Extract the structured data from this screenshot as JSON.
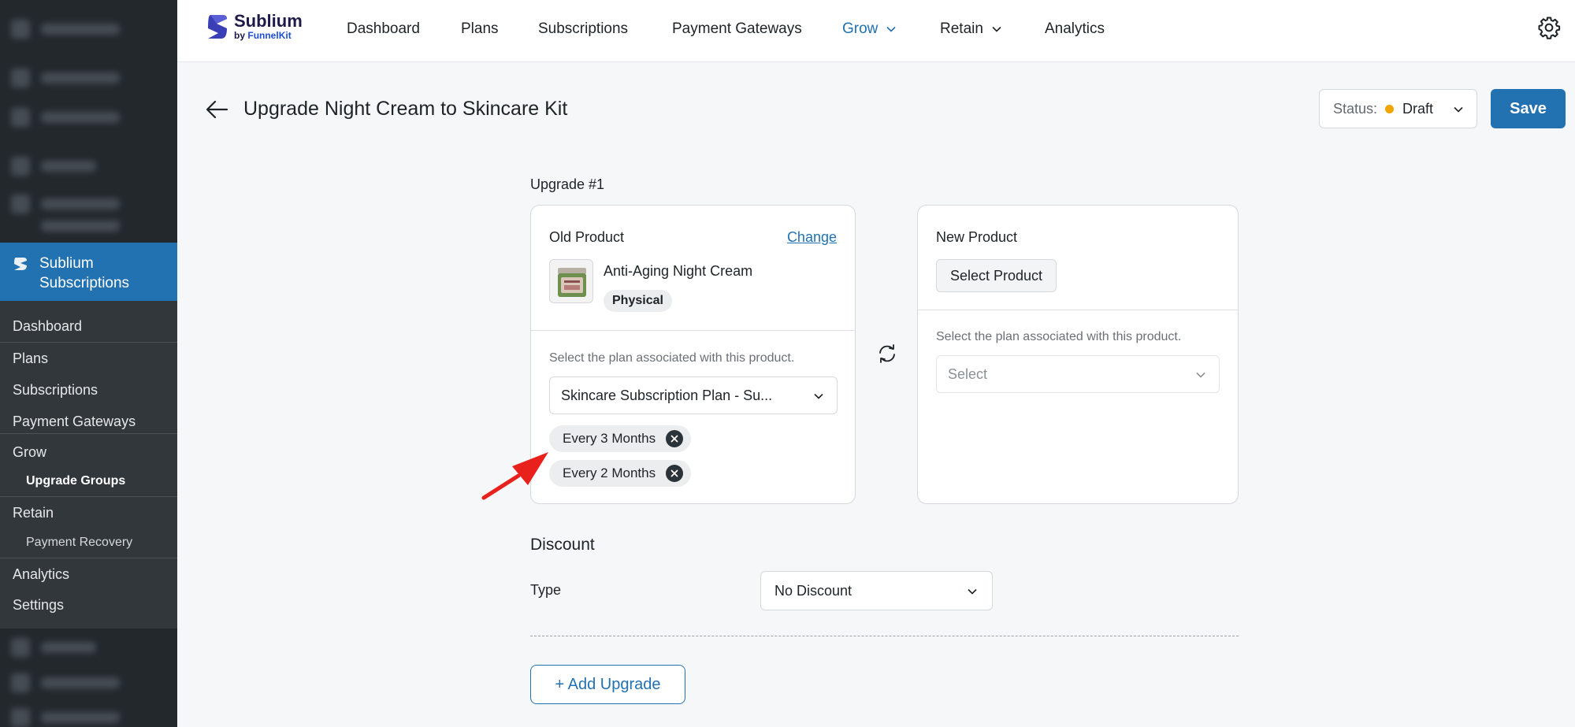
{
  "sidebar": {
    "menu_head_label": "Sublium Subscriptions",
    "items": [
      {
        "label": "Dashboard"
      },
      {
        "label": "Plans"
      },
      {
        "label": "Subscriptions"
      },
      {
        "label": "Payment Gateways"
      },
      {
        "label": "Grow"
      },
      {
        "label": "Upgrade Groups"
      },
      {
        "label": "Retain"
      },
      {
        "label": "Payment Recovery"
      },
      {
        "label": "Analytics"
      },
      {
        "label": "Settings"
      }
    ]
  },
  "topnav": {
    "brand_name": "Sublium",
    "brand_by": "by",
    "brand_by_company": "FunnelKit",
    "items": [
      {
        "label": "Dashboard"
      },
      {
        "label": "Plans"
      },
      {
        "label": "Subscriptions"
      },
      {
        "label": "Payment Gateways"
      },
      {
        "label": "Grow"
      },
      {
        "label": "Retain"
      },
      {
        "label": "Analytics"
      }
    ],
    "active": "Grow",
    "accent_color": "#2271b1"
  },
  "header": {
    "title": "Upgrade Night Cream to Skincare Kit",
    "status_label": "Status:",
    "status_value": "Draft",
    "status_color": "#f0a500",
    "save_label": "Save"
  },
  "upgrade": {
    "label": "Upgrade #1",
    "old_product": {
      "title": "Old Product",
      "change_label": "Change",
      "product_name": "Anti-Aging Night Cream",
      "product_type": "Physical",
      "plan_hint": "Select the plan associated with this product.",
      "plan_value": "Skincare Subscription Plan - Su...",
      "chips": [
        "Every 3 Months",
        "Every 2 Months"
      ]
    },
    "new_product": {
      "title": "New Product",
      "select_product_label": "Select Product",
      "plan_hint": "Select the plan associated with this product.",
      "plan_placeholder": "Select"
    }
  },
  "discount": {
    "title": "Discount",
    "type_label": "Type",
    "type_value": "No Discount"
  },
  "add_upgrade_label": "+ Add Upgrade"
}
